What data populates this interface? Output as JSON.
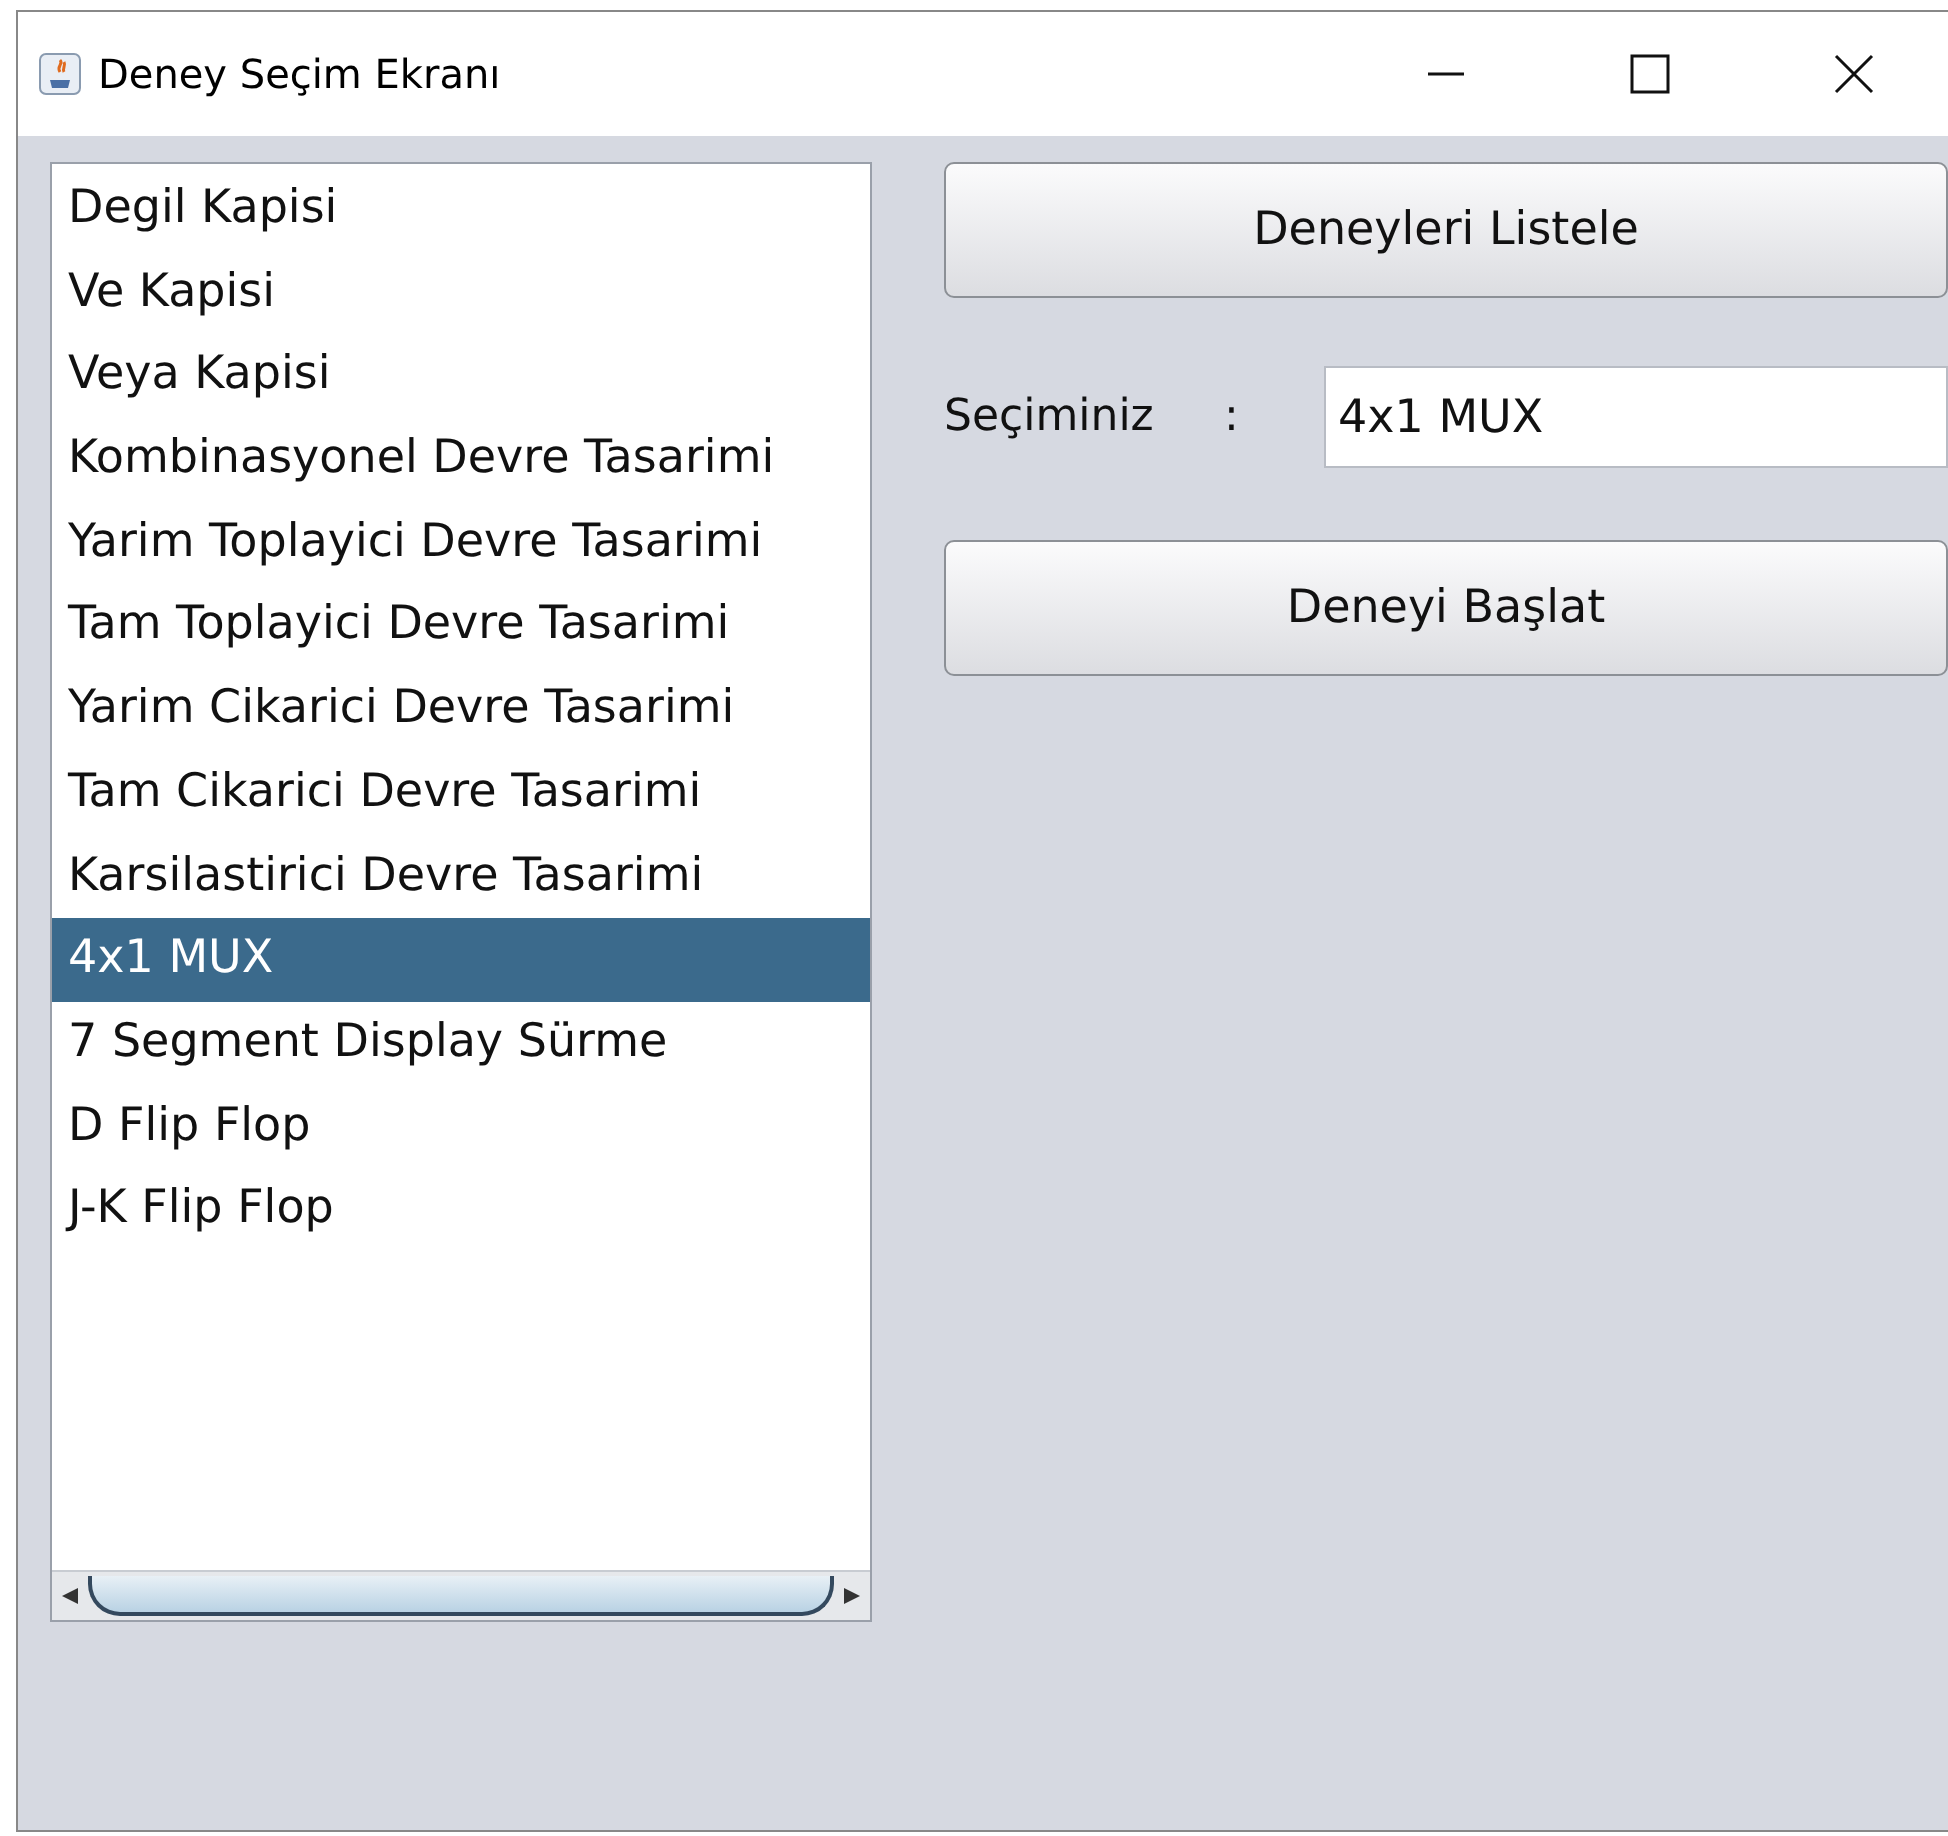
{
  "window": {
    "title": "Deney Seçim Ekranı"
  },
  "list": {
    "items": [
      {
        "label": "Degil Kapisi",
        "selected": false
      },
      {
        "label": "Ve Kapisi",
        "selected": false
      },
      {
        "label": "Veya Kapisi",
        "selected": false
      },
      {
        "label": "Kombinasyonel Devre Tasarimi",
        "selected": false
      },
      {
        "label": "Yarim Toplayici Devre Tasarimi",
        "selected": false
      },
      {
        "label": "Tam Toplayici Devre Tasarimi",
        "selected": false
      },
      {
        "label": "Yarim Cikarici Devre Tasarimi",
        "selected": false
      },
      {
        "label": "Tam Cikarici Devre Tasarimi",
        "selected": false
      },
      {
        "label": "Karsilastirici Devre Tasarimi",
        "selected": false
      },
      {
        "label": "4x1 MUX",
        "selected": true
      },
      {
        "label": "7 Segment Display Sürme",
        "selected": false
      },
      {
        "label": "D Flip Flop",
        "selected": false
      },
      {
        "label": "J-K Flip Flop",
        "selected": false
      }
    ]
  },
  "list_button": {
    "label": "Deneyleri Listele"
  },
  "selection": {
    "label": "Seçiminiz",
    "colon": ":",
    "value": "4x1 MUX"
  },
  "start_button": {
    "label": "Deneyi Başlat"
  }
}
